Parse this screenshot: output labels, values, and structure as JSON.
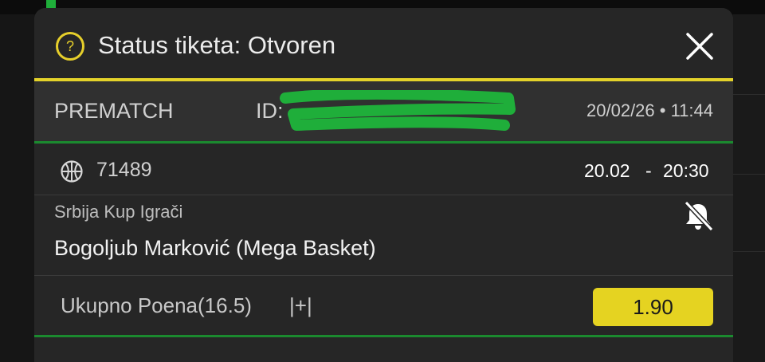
{
  "modal": {
    "title": "Status tiketa: Otvoren",
    "help_icon": "question-circle-icon",
    "close_icon": "close-icon"
  },
  "ticket": {
    "type": "PREMATCH",
    "id_label": "ID:",
    "date_time": "20/02/26 • 11:44"
  },
  "event": {
    "sport_icon": "basketball-icon",
    "code": "71489",
    "date": "20.02",
    "separator": "-",
    "time": "20:30",
    "competition": "Srbija Kup Igrači",
    "participant": "Bogoljub Marković (Mega Basket)",
    "notification_icon": "bell-off-icon"
  },
  "selection": {
    "market": "Ukupno Poena(16.5)",
    "pick": "|+|",
    "odds": "1.90"
  },
  "colors": {
    "accent_yellow": "#e3d22a",
    "accent_green": "#1b8a2f",
    "redaction_green": "#1fae3a",
    "modal_bg": "#262626",
    "ticket_row_bg": "#303030"
  }
}
